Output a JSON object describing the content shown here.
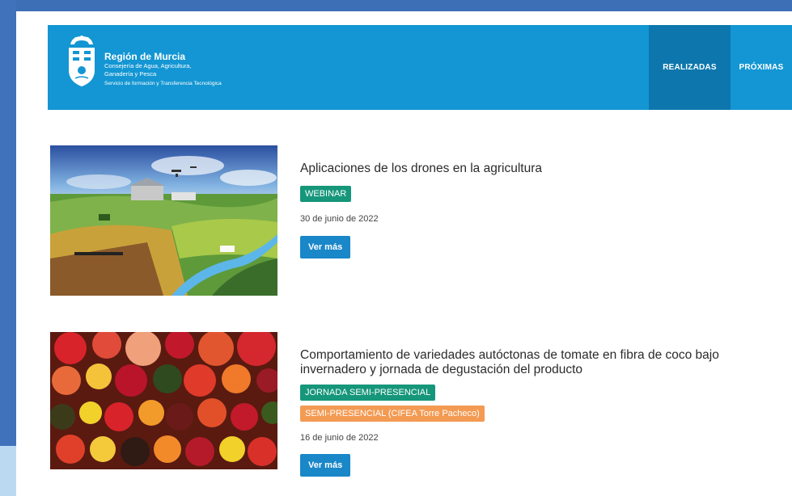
{
  "header": {
    "brand_title": "Región de Murcia",
    "brand_line2": "Consejería de Agua, Agricultura,",
    "brand_line3": "Ganadería y Pesca",
    "brand_line4": "Servicio de formación y Transferencia Tecnológica",
    "nav": [
      {
        "label": "REALIZADAS",
        "active": true
      },
      {
        "label": "PRÓXIMAS",
        "active": false
      }
    ]
  },
  "events": [
    {
      "title": "Aplicaciones de los drones en la agricultura",
      "badges": [
        {
          "label": "WEBINAR",
          "color": "#16967a"
        }
      ],
      "date": "30 de junio de 2022",
      "button": "Ver más"
    },
    {
      "title": "Comportamiento de variedades autóctonas de tomate en fibra de coco bajo invernadero y jornada de degustación del producto",
      "badges": [
        {
          "label": "JORNADA SEMI-PRESENCIAL",
          "color": "#16967a"
        },
        {
          "label": "SEMI-PRESENCIAL (CIFEA Torre Pacheco)",
          "color": "#f39a53"
        }
      ],
      "date": "16 de junio de 2022",
      "button": "Ver más"
    }
  ],
  "colors": {
    "header_bg": "#1396d3",
    "nav_active_bg": "#0d77ad",
    "badge_green": "#16967a",
    "badge_orange": "#f39a53",
    "button_bg": "#1a87c8"
  }
}
